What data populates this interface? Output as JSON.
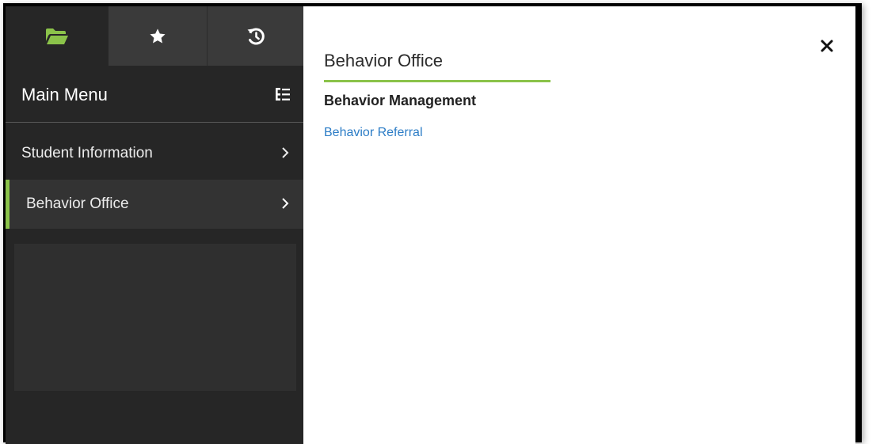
{
  "sidebar": {
    "tabs": [
      {
        "icon": "folder-open-icon",
        "active": true
      },
      {
        "icon": "star-icon",
        "active": false
      },
      {
        "icon": "history-icon",
        "active": false
      }
    ],
    "menu_title": "Main Menu",
    "menu_toggle_icon": "list-tree-icon",
    "items": [
      {
        "label": "Student Information",
        "active": false
      },
      {
        "label": "Behavior Office",
        "active": true
      }
    ]
  },
  "content": {
    "title": "Behavior Office",
    "section_heading": "Behavior Management",
    "links": [
      {
        "label": "Behavior Referral"
      }
    ],
    "close_icon": "close-icon"
  },
  "colors": {
    "accent": "#8bc34a",
    "sidebar_bg": "#262626",
    "link": "#2b7cc6"
  }
}
